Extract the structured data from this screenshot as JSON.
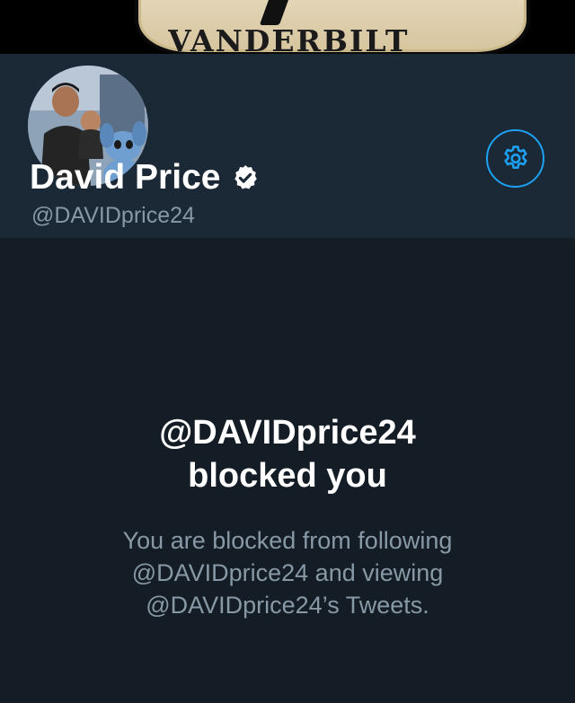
{
  "banner": {
    "text": "VANDERBILT"
  },
  "profile": {
    "display_name": "David Price",
    "handle": "@DAVIDprice24",
    "verified": true,
    "avatar_icon": "avatar-photo",
    "settings_icon": "gear-icon"
  },
  "blocked": {
    "title_line1": "@DAVIDprice24",
    "title_line2": "blocked you",
    "desc_line1": "You are blocked from following",
    "desc_line2": "@DAVIDprice24 and viewing",
    "desc_line3": "@DAVIDprice24’s Tweets."
  },
  "colors": {
    "background": "#141d26",
    "header_panel": "#1b2836",
    "accent": "#1da1f2",
    "text_primary": "#ffffff",
    "text_secondary": "#8899a6"
  }
}
